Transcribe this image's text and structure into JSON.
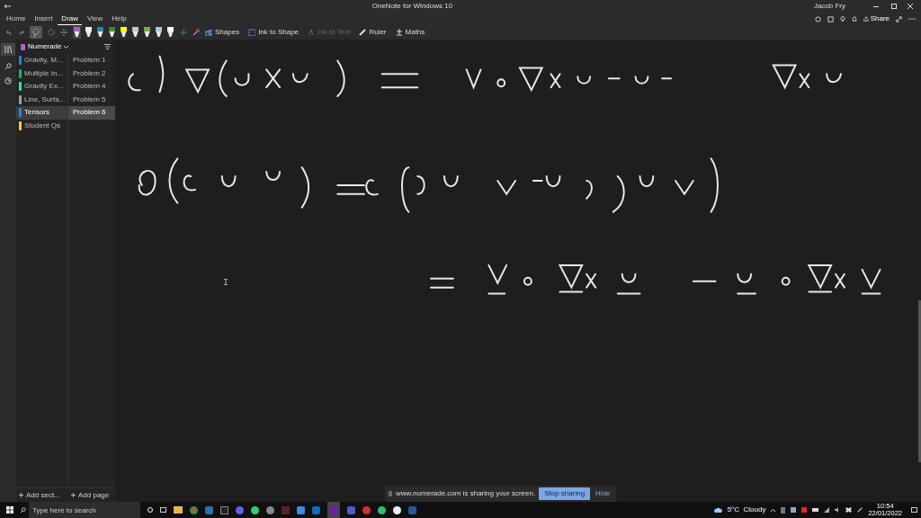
{
  "window": {
    "title": "OneNote for Windows 10",
    "user": "Jacob Fry"
  },
  "ribbon_tabs": [
    {
      "label": "Home",
      "selected": false
    },
    {
      "label": "Insert",
      "selected": false
    },
    {
      "label": "Draw",
      "selected": true
    },
    {
      "label": "View",
      "selected": false
    },
    {
      "label": "Help",
      "selected": false
    }
  ],
  "pens": [
    {
      "color": "#a060c0",
      "selected": true
    },
    {
      "color": "#f0f0f0",
      "selected": false
    },
    {
      "color": "#1e8aa8",
      "selected": false
    },
    {
      "color": "#3a8a3a",
      "selected": false
    },
    {
      "color": "#ffff00",
      "selected": false
    },
    {
      "color": "#c8c8c8",
      "selected": false
    },
    {
      "color": "#7aa84f",
      "selected": false
    },
    {
      "color": "#9fd0e0",
      "selected": false
    },
    {
      "color": "#ffffff",
      "selected": false
    }
  ],
  "tools": [
    {
      "kind": "shapes",
      "label": "Shapes",
      "disabled": false
    },
    {
      "kind": "ink-shape",
      "label": "Ink to Shape",
      "disabled": false
    },
    {
      "kind": "ink-text",
      "label": "Ink to Text",
      "disabled": true
    },
    {
      "kind": "ruler",
      "label": "Ruler",
      "disabled": false
    },
    {
      "kind": "maths",
      "label": "Maths",
      "disabled": false
    }
  ],
  "share_label": "Share",
  "notebook": {
    "name": "Numerade"
  },
  "sections": [
    {
      "label": "Gravity, M...",
      "color": "#1e88e5",
      "selected": false
    },
    {
      "label": "Multiple In...",
      "color": "#00c853",
      "selected": false
    },
    {
      "label": "Gravity Ex...",
      "color": "#1de9b6",
      "selected": false
    },
    {
      "label": "Line, Surfa...",
      "color": "#90a4ae",
      "selected": false
    },
    {
      "label": "Tensors",
      "color": "#1e88e5",
      "selected": true
    },
    {
      "label": "Student Qs",
      "color": "#ffca28",
      "selected": false
    }
  ],
  "pages": [
    {
      "label": "Problem 1",
      "selected": false
    },
    {
      "label": "Problem 2",
      "selected": false
    },
    {
      "label": "Problem 4",
      "selected": false
    },
    {
      "label": "Problem 5",
      "selected": false
    },
    {
      "label": "Problem 6",
      "selected": true
    }
  ],
  "footer": {
    "add_section": "Add sect...",
    "add_page": "Add page"
  },
  "share_bar": {
    "message": "www.numerade.com is sharing your screen.",
    "stop": "Stop sharing",
    "hide": "Hide"
  },
  "taskbar": {
    "search_placeholder": "Type here to search",
    "weather": "5°C  Cloudy",
    "time": "10:54",
    "date": "22/01/2022"
  }
}
